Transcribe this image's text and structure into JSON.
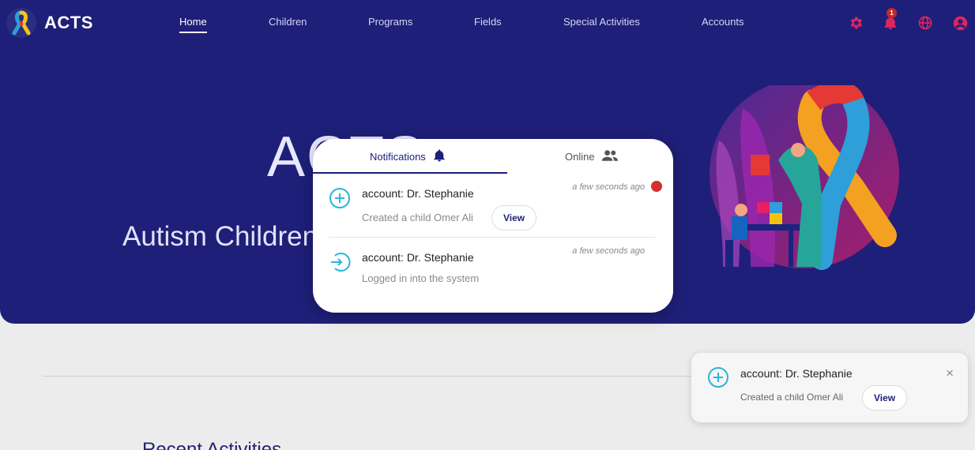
{
  "app": {
    "name": "ACTS"
  },
  "nav": {
    "items": [
      {
        "label": "Home",
        "active": true
      },
      {
        "label": "Children",
        "active": false
      },
      {
        "label": "Programs",
        "active": false
      },
      {
        "label": "Fields",
        "active": false
      },
      {
        "label": "Special Activities",
        "active": false
      },
      {
        "label": "Accounts",
        "active": false
      }
    ],
    "icons": [
      "gear-icon",
      "bell-icon",
      "globe-icon",
      "account-icon"
    ],
    "notification_count": "1"
  },
  "hero": {
    "title": "ACTS",
    "subtitle": "Autism Children"
  },
  "popover": {
    "tabs": {
      "notifications": "Notifications",
      "online": "Online"
    },
    "items": [
      {
        "title": "account: Dr. Stephanie",
        "description": "Created a child Omer Ali",
        "time": "a few seconds ago",
        "action": "View",
        "unread": true,
        "icon": "plus-circle-icon"
      },
      {
        "title": "account: Dr. Stephanie",
        "description": "Logged in into the system",
        "time": "a few seconds ago",
        "icon": "login-icon"
      }
    ]
  },
  "toast": {
    "title": "account: Dr. Stephanie",
    "description": "Created a child Omer Ali",
    "action": "View",
    "close": "×",
    "icon": "plus-circle-icon"
  },
  "section": {
    "title": "Recent Activities"
  },
  "colors": {
    "primary": "#1e1f78",
    "accent": "#e0245e",
    "info": "#29b6d8",
    "alert": "#d32f2f"
  }
}
